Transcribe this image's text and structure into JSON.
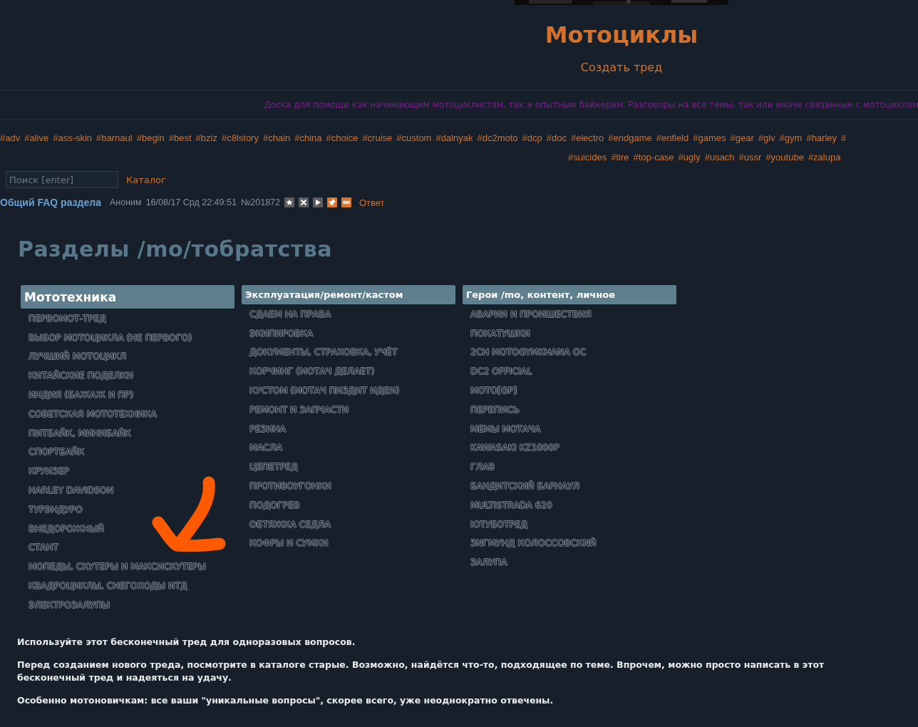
{
  "board": {
    "title": "Мотоциклы",
    "create_thread": "Создать тред",
    "description": "Доска для помощи как начинающим мотоциклистам, так и опытным байкерам. Разговоры на все темы, так или иначе связанные с мотоциклам"
  },
  "tag_lines": [
    [
      "#adv",
      "#alive",
      "#ass-skin",
      "#barnaul",
      "#begin",
      "#best",
      "#bziz",
      "#c8lstory",
      "#chain",
      "#china",
      "#choice",
      "#cruise",
      "#custom",
      "#dalnyak",
      "#dc2moto",
      "#dcp",
      "#doc",
      "#electro",
      "#endgame",
      "#enfield",
      "#games",
      "#gear",
      "#glv",
      "#gym",
      "#harley",
      "#"
    ],
    [
      "#suicides",
      "#tire",
      "#top-case",
      "#ugly",
      "#usach",
      "#ussr",
      "#youtube",
      "#zalupa"
    ]
  ],
  "search": {
    "placeholder": "Поиск [enter]"
  },
  "catalog_link": "Каталог",
  "post": {
    "subject": "Общий FAQ раздела",
    "author": "Аноним",
    "date": "16/08/17 Срд 22:49:51",
    "number": "№201872",
    "buttons": [
      {
        "kind": "star",
        "color": "#5c5c5c"
      },
      {
        "kind": "close",
        "color": "#5c5c5c"
      },
      {
        "kind": "play",
        "color": "#5c5c5c"
      },
      {
        "kind": "pin",
        "color": "#d9772f"
      },
      {
        "kind": "loop",
        "color": "#d9772f"
      }
    ],
    "reply": "Ответ"
  },
  "sections": {
    "title": "Разделы /mo/тобратства",
    "columns": [
      {
        "heading": "Мототехника",
        "large": true,
        "items": [
          "ПЕРВОМОТ-ТРЕД",
          "ВЫБОР МОТОЦИКЛА (НЕ ПЕРВОГО)",
          "ЛУЧШИЙ МОТОЦИКЛ",
          "КИТАЙСКИЕ ПОДЕЛКИ",
          "ИНДИЯ (БАЖАЖ И ПР)",
          "СОВЕТСКАЯ МОТОТЕХНИКА",
          "ПИТБАЙК, МИНИБАЙК",
          "СПОРТБАЙК",
          "КРУИЗЕР",
          "HARLEY DAVIDSON",
          "ТУРЭНДУРО",
          "ВНЕДОРОЖНЫЙ",
          "СТАНТ",
          "МОПЕДЫ, СКУТЕРЫ И МАКСИСКУТЕРЫ",
          "КВАДРОЦИКЛЫ, СНЕГОХОДЫ ИТД",
          "ЭЛЕКТРОЗАЛУПЫ"
        ]
      },
      {
        "heading": "Эксплуатация/ремонт/кастом",
        "large": false,
        "items": [
          "СДАЕМ НА ПРАВА",
          "ЭКИПИРОВКА",
          "ДОКУМЕНТЫ, СТРАХОВКА, УЧЁТ",
          "КОРЧИНГ (МОТАЧ ДЕЛАЕТ)",
          "КУСТОМ (МОТАЧ ПИЗДИТ ИДЕИ)",
          "РЕМОНТ И ЗАПЧАСТИ",
          "РЕЗИНА",
          "МАСЛА",
          "ЦЕПЕТРЕД",
          "ПРОТИВОУГОНКИ",
          "ПОДОГРЕВ",
          "ОБТЯЖКА СЕДЛА",
          "КОФРЫ И СУМКИ"
        ]
      },
      {
        "heading": "Герои /mo, контент, личное",
        "large": false,
        "items": [
          "АВАРИИ И ПРОИШЕСТВИЯ",
          "ПОКАТУШКИ",
          "2CH MOTOGYMKHANA OC",
          "DC2 OFFICIAL",
          "MOTO[GP]",
          "ПЕРЕПИСЬ",
          "МЕМЫ МОТАЧА",
          "KAWASAKI KZ1000P",
          "ГЛАВ",
          "БАНДИТСКИЙ БАРНАУЛ",
          "MULTISTRADA 620",
          "ЮТУБОТРЕД",
          "ЗNГМУНД КОЛОССОВСКNЙ",
          "ЗАЛУПА"
        ]
      }
    ]
  },
  "paragraphs": [
    "Используйте этот бесконечный тред для одноразовых вопросов.",
    "Перед созданием нового треда, посмотрите в каталоге старые. Возможно, найдётся что-то, подходящее по теме. Впрочем, можно просто написать в этот бесконечный тред и надеяться на удачу.",
    "Особенно мотоновичкам: все ваши \"уникальные вопросы\", скорее всего, уже неоднократно отвечены."
  ]
}
